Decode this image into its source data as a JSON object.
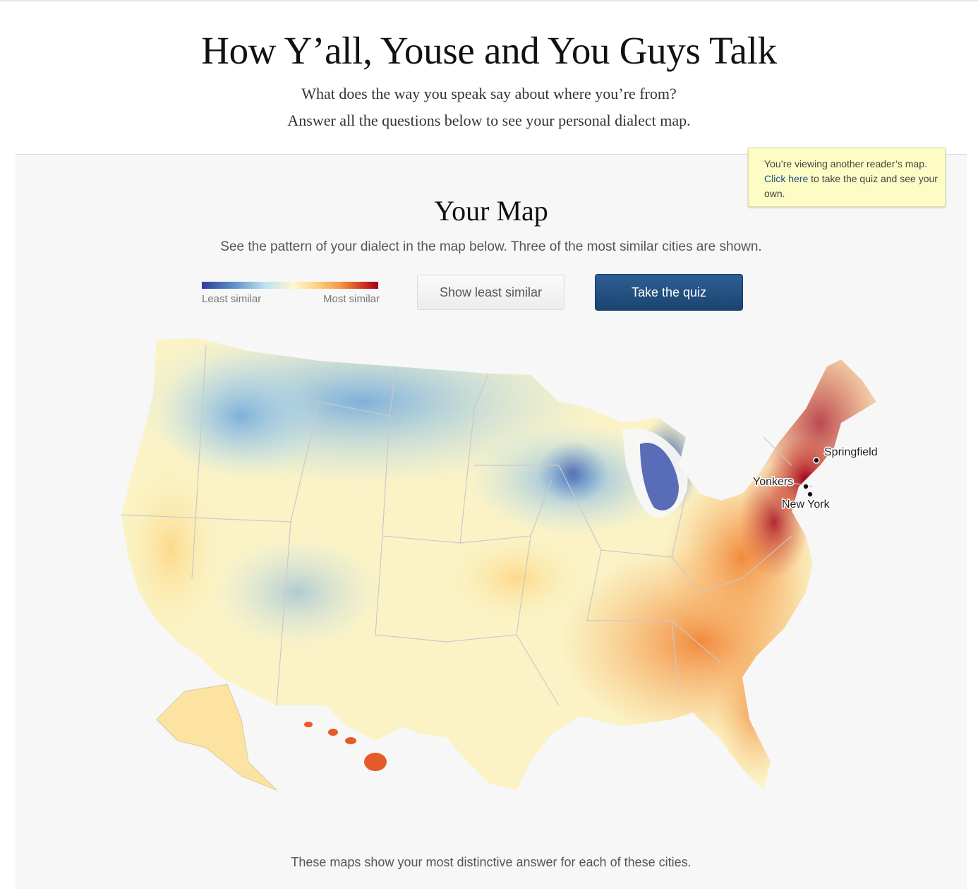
{
  "page": {
    "title": "How Y’all, Youse and You Guys Talk",
    "subtitle_line1": "What does the way you speak say about where you’re from?",
    "subtitle_line2": "Answer all the questions below to see your personal dialect map."
  },
  "notice": {
    "text_before": "You’re viewing another reader’s map. ",
    "link": "Click here",
    "text_after": " to take the quiz and see your own."
  },
  "map_section": {
    "title": "Your Map",
    "description": "See the pattern of your dialect in the map below. Three of the most similar cities are shown.",
    "footer": "These maps show your most distinctive answer for each of these cities."
  },
  "legend": {
    "least": "Least similar",
    "most": "Most similar",
    "colors": [
      "#2c3e9c",
      "#5f8ec8",
      "#bfe2ef",
      "#fbf8cf",
      "#fdd68a",
      "#f59a4b",
      "#d73f22",
      "#a0001f"
    ]
  },
  "buttons": {
    "show_least": "Show least similar",
    "take_quiz": "Take the quiz"
  },
  "cities": [
    {
      "name": "Springfield"
    },
    {
      "name": "Yonkers"
    },
    {
      "name": "New York"
    }
  ],
  "colors": {
    "quiz_button": "#1f4a78",
    "notice_bg": "#fdfcc4",
    "panel_bg": "#f7f7f7"
  }
}
